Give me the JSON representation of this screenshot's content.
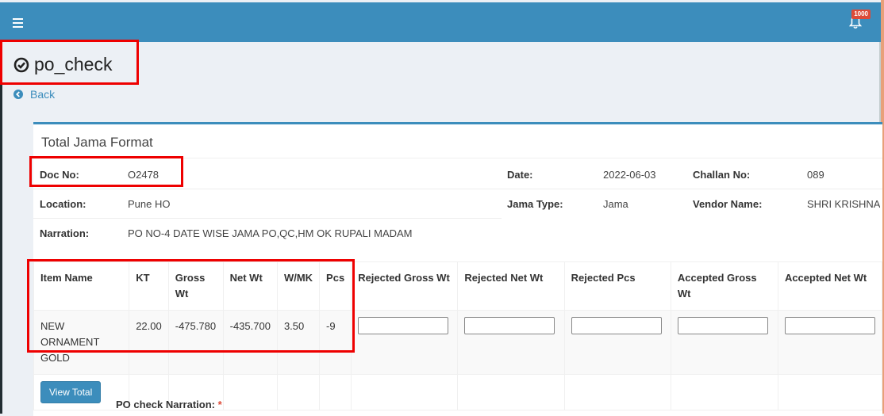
{
  "topbar": {
    "notification_count": "1000"
  },
  "page": {
    "title": "po_check",
    "back_label": "Back"
  },
  "box": {
    "title": "Total Jama Format",
    "fields": {
      "doc_no_label": "Doc No:",
      "doc_no_value": "O2478",
      "date_label": "Date:",
      "date_value": "2022-06-03",
      "challan_label": "Challan No:",
      "challan_value": "089",
      "location_label": "Location:",
      "location_value": "Pune HO",
      "jama_type_label": "Jama Type:",
      "jama_type_value": "Jama",
      "vendor_label": "Vendor Name:",
      "vendor_value": "SHRI KRISHNA G",
      "narration_label": "Narration:",
      "narration_value": "PO NO-4 DATE WISE JAMA PO,QC,HM OK RUPALI MADAM"
    }
  },
  "table": {
    "headers": [
      "Item Name",
      "KT",
      "Gross Wt",
      "Net Wt",
      "W/MK",
      "Pcs",
      "Rejected Gross Wt",
      "Rejected Net Wt",
      "Rejected Pcs",
      "Accepted Gross Wt",
      "Accepted Net Wt"
    ],
    "row": {
      "item_name": "NEW ORNAMENT GOLD",
      "kt": "22.00",
      "gross_wt": "-475.780",
      "net_wt": "-435.700",
      "wmk": "3.50",
      "pcs": "-9"
    },
    "view_total_label": "View Total"
  },
  "po_narration_label": "PO check Narration:",
  "required_mark": "*"
}
